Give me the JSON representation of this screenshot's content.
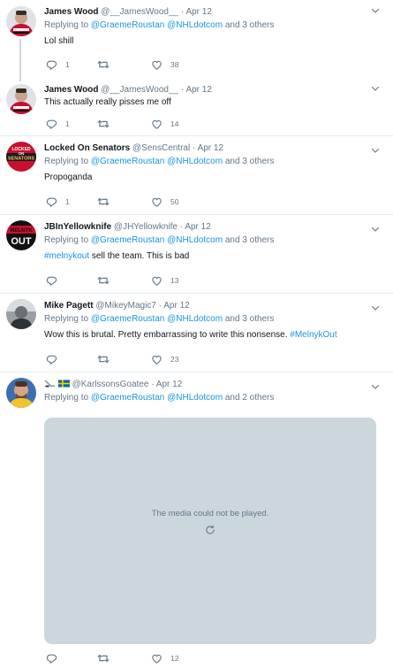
{
  "colors": {
    "link": "#1b95e0",
    "muted": "#657786",
    "border": "#e6ecf0",
    "media_bg": "#ccd6dd"
  },
  "icons": {
    "reply": "reply-icon",
    "retweet": "retweet-icon",
    "like": "heart-icon",
    "more": "chevron-down-icon",
    "reload": "reload-icon"
  },
  "tweets": [
    {
      "name": "James Wood",
      "handle": "@__JamesWood__",
      "dot": "·",
      "time": "Apr 12",
      "replying_prefix": "Replying to",
      "mention1": "@GraemeRoustan",
      "mention2": "@NHLdotcom",
      "others": "and 3 others",
      "text": "Lol shill",
      "replies": "1",
      "retweets": "",
      "likes": "38"
    },
    {
      "name": "James Wood",
      "handle": "@__JamesWood__",
      "dot": "·",
      "time": "Apr 12",
      "text": "This actually really pisses me off",
      "replies": "1",
      "retweets": "",
      "likes": "14"
    },
    {
      "name": "Locked On Senators",
      "handle": "@SensCentral",
      "dot": "·",
      "time": "Apr 12",
      "replying_prefix": "Replying to",
      "mention1": "@GraemeRoustan",
      "mention2": "@NHLdotcom",
      "others": "and 3 others",
      "text": "Propoganda",
      "replies": "1",
      "retweets": "",
      "likes": "50",
      "avatar_text": [
        "LOCKED",
        "ON",
        "SENATORS"
      ]
    },
    {
      "name": "JBInYellowknife",
      "handle": "@JHYellowknife",
      "dot": "·",
      "time": "Apr 12",
      "replying_prefix": "Replying to",
      "mention1": "@GraemeRoustan",
      "mention2": "@NHLdotcom",
      "others": "and 3 others",
      "hashtag": "#melnykout",
      "text": " sell the team. This is bad",
      "replies": "",
      "retweets": "",
      "likes": "13",
      "avatar_text": [
        "MELNYK",
        "OUT"
      ]
    },
    {
      "name": "Mike Pagett",
      "handle": "@MikeyMagic7",
      "dot": "·",
      "time": "Apr 12",
      "replying_prefix": "Replying to",
      "mention1": "@GraemeRoustan",
      "mention2": "@NHLdotcom",
      "others": "and 3 others",
      "text": "Wow this is brutal. Pretty embarrassing to write this nonsense. ",
      "hashtag": "#MelnykOut",
      "replies": "",
      "retweets": "",
      "likes": "23"
    },
    {
      "name": "",
      "handle": "@KarlssonsGoatee",
      "dot": "·",
      "time": "Apr 12",
      "replying_prefix": "Replying to",
      "mention1": "@GraemeRoustan",
      "mention2": "@NHLdotcom",
      "others": "and 2 others",
      "media_message": "The media could not be played.",
      "replies": "",
      "retweets": "",
      "likes": "12"
    }
  ]
}
